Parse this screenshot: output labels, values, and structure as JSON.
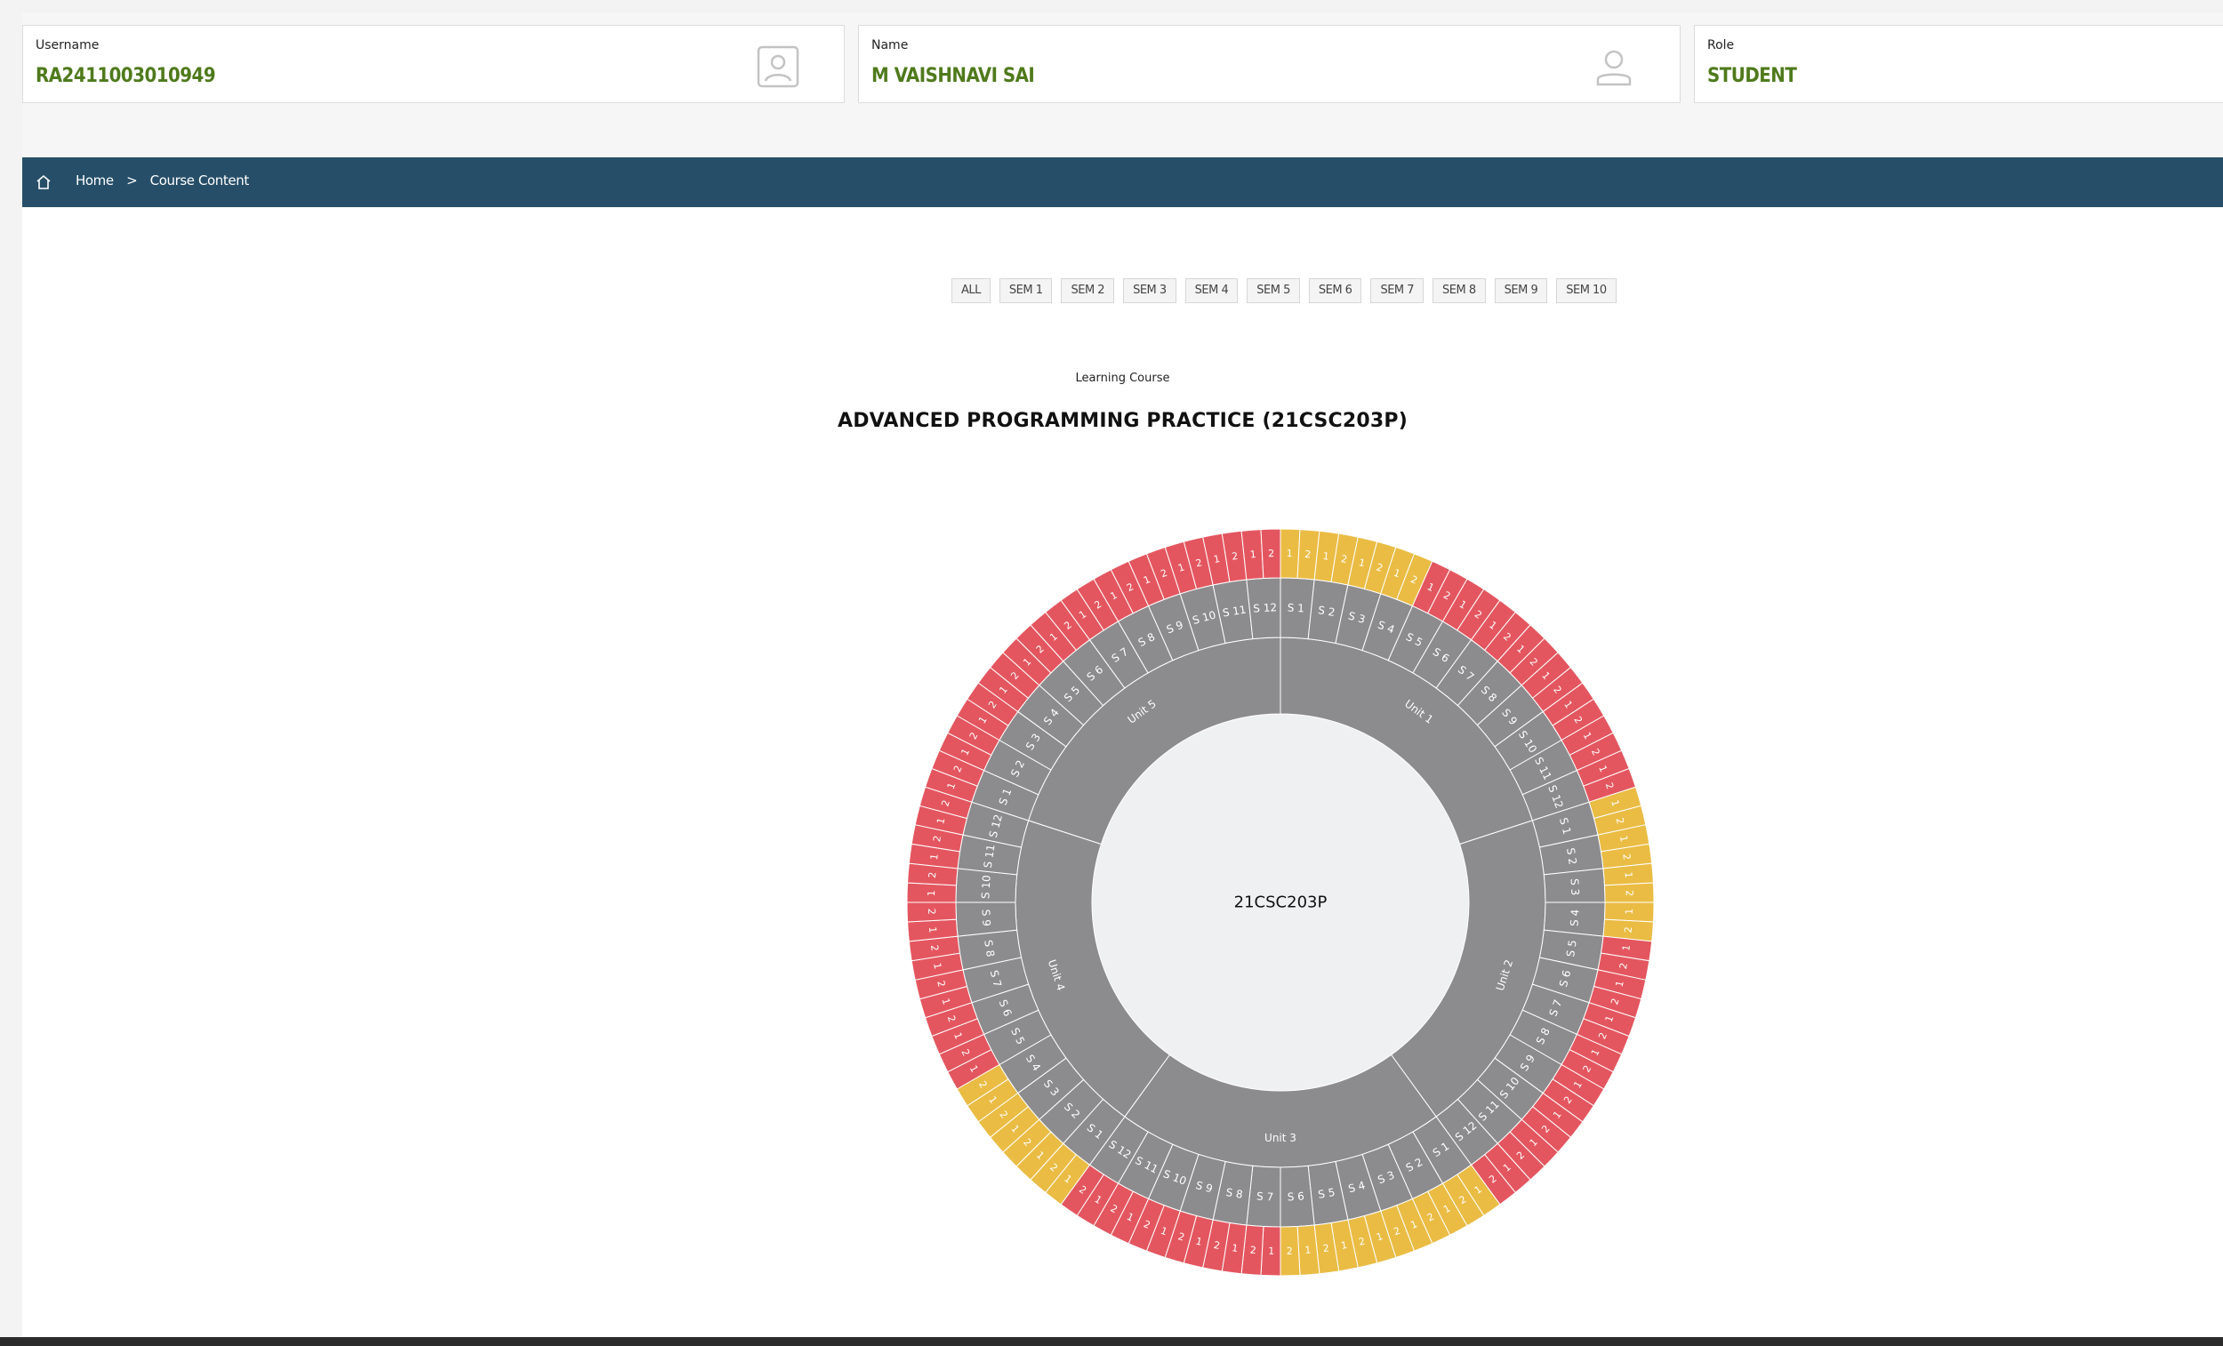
{
  "cards": [
    {
      "label": "Username",
      "value": "RA2411003010949",
      "icon": "id-card-icon"
    },
    {
      "label": "Name",
      "value": "M VAISHNAVI SAI",
      "icon": "user-icon"
    },
    {
      "label": "Role",
      "value": "STUDENT",
      "icon": ""
    }
  ],
  "breadcrumb": {
    "home": "Home",
    "separator": ">",
    "current": "Course Content"
  },
  "sem_tabs": [
    "ALL",
    "SEM 1",
    "SEM 2",
    "SEM 3",
    "SEM 4",
    "SEM 5",
    "SEM 6",
    "SEM 7",
    "SEM 8",
    "SEM 9",
    "SEM 10"
  ],
  "course": {
    "label": "Learning Course",
    "title": "ADVANCED PROGRAMMING PRACTICE (21CSC203P)",
    "code": "21CSC203P"
  },
  "colors": {
    "header_bar": "#264e68",
    "value_green": "#4f7a1c",
    "ring_gray": "#8c8c8e",
    "red": "#e4565f",
    "yellow": "#eabc44",
    "center": "#eff0f2"
  },
  "sunburst": {
    "units": [
      {
        "name": "Unit 1",
        "sessions": [
          "S 1",
          "S 2",
          "S 3",
          "S 4",
          "S 5",
          "S 6",
          "S 7",
          "S 8",
          "S 9",
          "S 10",
          "S 11",
          "S 12"
        ],
        "status": [
          "Y",
          "Y",
          "Y",
          "Y",
          "R",
          "R",
          "R",
          "R",
          "R",
          "R",
          "R",
          "R"
        ]
      },
      {
        "name": "Unit 2",
        "sessions": [
          "S 1",
          "S 2",
          "S 3",
          "S 4",
          "S 5",
          "S 6",
          "S 7",
          "S 8",
          "S 9",
          "S 10",
          "S 11",
          "S 12"
        ],
        "status": [
          "Y",
          "Y",
          "Y",
          "Y",
          "R",
          "R",
          "R",
          "R",
          "R",
          "R",
          "R",
          "R"
        ]
      },
      {
        "name": "Unit 3",
        "sessions": [
          "S 1",
          "S 2",
          "S 3",
          "S 4",
          "S 5",
          "S 6",
          "S 7",
          "S 8",
          "S 9",
          "S 10",
          "S 11",
          "S 12"
        ],
        "status": [
          "Y",
          "Y",
          "Y",
          "Y",
          "Y",
          "Y",
          "R",
          "R",
          "R",
          "R",
          "R",
          "R"
        ]
      },
      {
        "name": "Unit 4",
        "sessions": [
          "S 1",
          "S 2",
          "S 3",
          "S 4",
          "S 5",
          "S 6",
          "S 7",
          "S 8",
          "S 9",
          "S 10",
          "S 11",
          "S 12"
        ],
        "status": [
          "Y",
          "Y",
          "Y",
          "Y",
          "R",
          "R",
          "R",
          "R",
          "R",
          "R",
          "R",
          "R"
        ]
      },
      {
        "name": "Unit 5",
        "sessions": [
          "S 1",
          "S 2",
          "S 3",
          "S 4",
          "S 5",
          "S 6",
          "S 7",
          "S 8",
          "S 9",
          "S 10",
          "S 11",
          "S 12"
        ],
        "status": [
          "R",
          "R",
          "R",
          "R",
          "R",
          "R",
          "R",
          "R",
          "R",
          "R",
          "R",
          "R"
        ]
      }
    ],
    "outer_labels": [
      "1",
      "2"
    ]
  }
}
